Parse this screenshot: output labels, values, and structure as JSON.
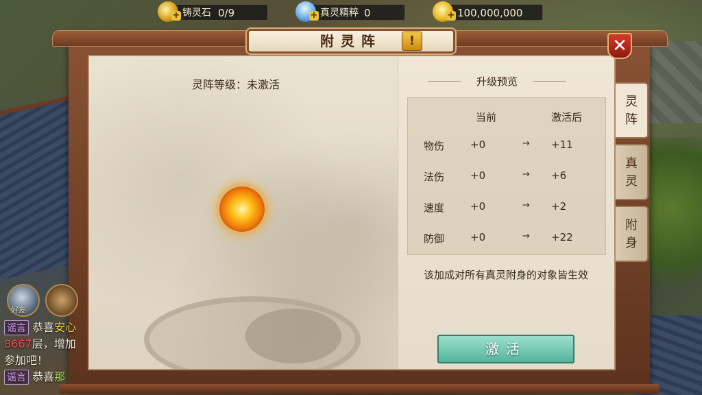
{
  "resources": [
    {
      "label": "铸灵石",
      "value": "0/9",
      "icon": "spirit-stone-icon"
    },
    {
      "label": "真灵精粹",
      "value": "0",
      "icon": "essence-bottle-icon"
    },
    {
      "label": "",
      "value": "100,000,000",
      "icon": "gold-ingot-icon"
    }
  ],
  "panel": {
    "title": "附灵阵",
    "help": "!",
    "close": "✕",
    "level_text": "灵阵等级：未激活",
    "preview_title": "升级预览",
    "col_current": "当前",
    "col_after": "激活后",
    "stats": [
      {
        "name": "物伤",
        "current": "+0",
        "arrow": "→",
        "after": "+11"
      },
      {
        "name": "法伤",
        "current": "+0",
        "arrow": "→",
        "after": "+6"
      },
      {
        "name": "速度",
        "current": "+0",
        "arrow": "→",
        "after": "+2"
      },
      {
        "name": "防御",
        "current": "+0",
        "arrow": "→",
        "after": "+22"
      }
    ],
    "note": "该加成对所有真灵附身的对象皆生效",
    "activate_label": "激活"
  },
  "tabs": [
    {
      "label": "灵\n阵",
      "active": true
    },
    {
      "label": "真\n灵",
      "active": false
    },
    {
      "label": "附\n身",
      "active": false
    }
  ],
  "chat": {
    "friend_label": "好友",
    "lines": [
      {
        "tag": "谣言",
        "text": "恭喜",
        "highlight": "安心"
      },
      {
        "text_red": "8667",
        "text": "层，增加"
      },
      {
        "text": "参加吧！"
      },
      {
        "tag": "谣言",
        "text": "恭喜",
        "highlight": "那"
      }
    ]
  },
  "colors": {
    "accent": "#8a5030",
    "activate": "#55b49c",
    "close": "#d23a2a"
  }
}
